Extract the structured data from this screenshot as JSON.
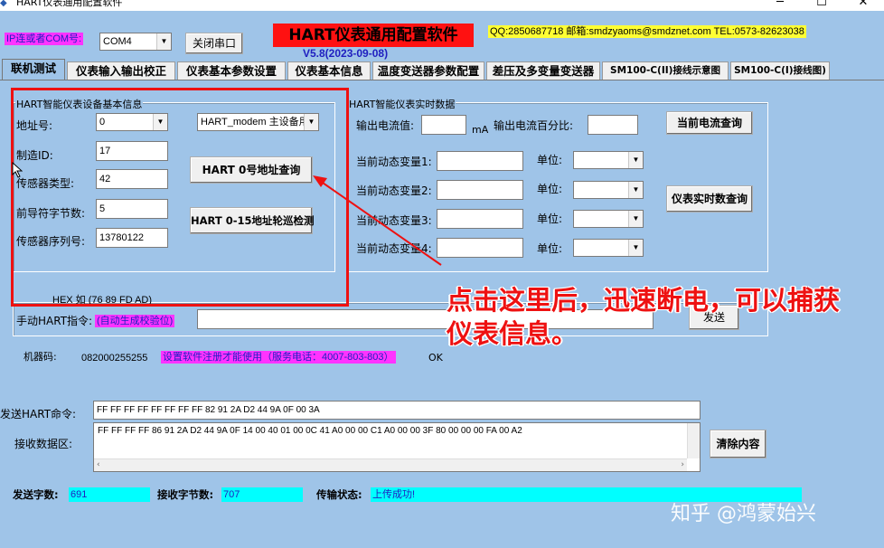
{
  "window": {
    "title": "HART仪表通用配置软件",
    "minimize": "─",
    "maximize": "☐",
    "close": "✕"
  },
  "header": {
    "com_label": "IP连或者COM号:",
    "com_value": "COM4",
    "close_port_button": "关闭串口",
    "app_title": "HART仪表通用配置软件",
    "version": "V5.8(2023-09-08)",
    "contact": "QQ:2850687718  邮箱:smdzyaoms@smdznet.com TEL:0573-82623038"
  },
  "tabs": [
    {
      "label": "联机测试"
    },
    {
      "label": "仪表输入输出校正"
    },
    {
      "label": "仪表基本参数设置"
    },
    {
      "label": "仪表基本信息"
    },
    {
      "label": "温度变送器参数配置"
    },
    {
      "label": "差压及多变量变送器"
    },
    {
      "label": "SM100-C(II)接线示意图"
    },
    {
      "label": "SM100-C(I)接线图)"
    }
  ],
  "basic_info": {
    "title": "HART智能仪表设备基本信息",
    "address_label": "地址号:",
    "address_value": "0",
    "modem_value": "HART_modem 主设备用",
    "maker_label": "制造ID:",
    "maker_value": "17",
    "sensor_type_label": "传感器类型:",
    "sensor_type_value": "42",
    "preamble_label": "前导符字节数:",
    "preamble_value": "5",
    "serial_label": "传感器序列号:",
    "serial_value": "13780122",
    "query0_button": "HART 0号地址查询",
    "poll_button": "HART 0-15地址轮巡检测"
  },
  "realtime": {
    "title": "HART智能仪表实时数据",
    "current_label": "输出电流值:",
    "current_unit": "mA",
    "percent_label": "输出电流百分比:",
    "current_query_button": "当前电流查询",
    "var1_label": "当前动态变量1:",
    "var2_label": "当前动态变量2:",
    "var3_label": "当前动态变量3:",
    "var4_label": "当前动态变量4:",
    "unit_label": "单位:",
    "realtime_query_button": "仪表实时数查询"
  },
  "manual": {
    "hex_hint": "HEX 如 (76 89 FD AD)",
    "cmd_label": "手动HART指令:",
    "auto_checksum": "(自动生成校验位)",
    "send_button": "发送"
  },
  "machine": {
    "label": "机器码:",
    "code": "082000255255",
    "register_notice": "设置软件注册才能使用（服务电话：4007-803-803）",
    "status": "OK"
  },
  "io": {
    "send_label": "发送HART命令:",
    "send_value": "FF FF FF FF FF FF FF FF 82 91 2A D2 44 9A 0F 00 3A",
    "recv_label": "接收数据区:",
    "recv_value": "FF FF FF FF 86 91 2A D2 44 9A 0F 14 00 40 01 00 0C 41 A0 00 00 C1 A0 00 00 3F 80 00 00 00 FA 00 A2",
    "clear_button": "清除内容"
  },
  "statusbar": {
    "sent_label": "发送字数:",
    "sent_value": "691",
    "recv_label": "接收字节数:",
    "recv_value": "707",
    "state_label": "传输状态:",
    "state_value": "上传成功!"
  },
  "annotation": {
    "line1": "点击这里后，迅速断电，可以捕获",
    "line2": "仪表信息。"
  },
  "watermark": "知乎 @鸿蒙始兴",
  "colors": {
    "background": "#9fc4e8",
    "magenta": "#ff33ff",
    "cyan": "#00ffff",
    "yellow": "#ffff33",
    "red": "#ee1111"
  }
}
